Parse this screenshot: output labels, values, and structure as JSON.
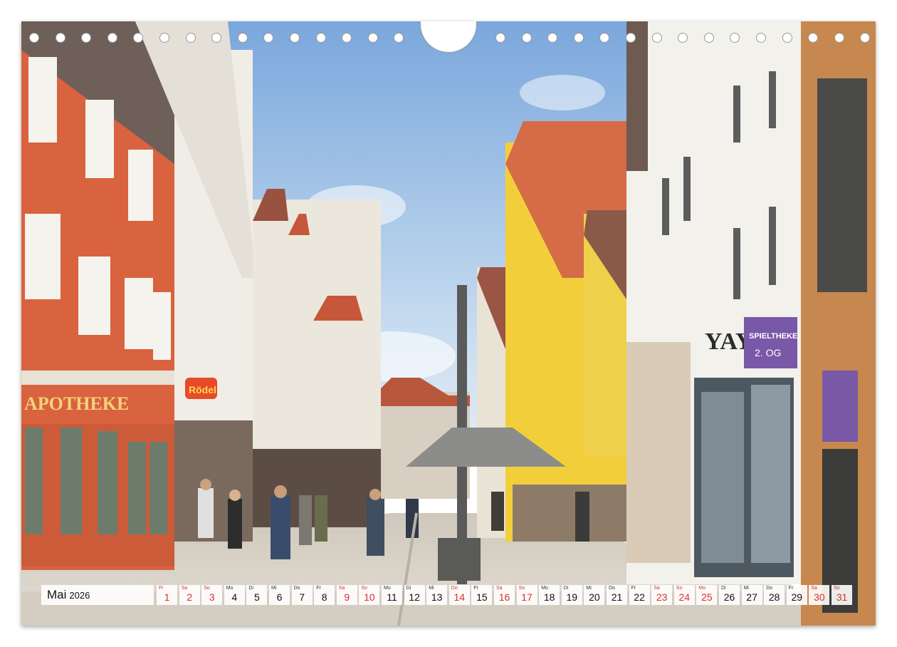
{
  "calendar": {
    "month": "Mai",
    "year": "2026",
    "highlight_color": "#d9302a",
    "days": [
      {
        "wd": "Fr",
        "d": "1",
        "hl": true
      },
      {
        "wd": "Sa",
        "d": "2",
        "hl": true
      },
      {
        "wd": "So",
        "d": "3",
        "hl": true
      },
      {
        "wd": "Mo",
        "d": "4",
        "hl": false
      },
      {
        "wd": "Di",
        "d": "5",
        "hl": false
      },
      {
        "wd": "Mi",
        "d": "6",
        "hl": false
      },
      {
        "wd": "Do",
        "d": "7",
        "hl": false
      },
      {
        "wd": "Fr",
        "d": "8",
        "hl": false
      },
      {
        "wd": "Sa",
        "d": "9",
        "hl": true
      },
      {
        "wd": "So",
        "d": "10",
        "hl": true
      },
      {
        "wd": "Mo",
        "d": "11",
        "hl": false
      },
      {
        "wd": "Di",
        "d": "12",
        "hl": false
      },
      {
        "wd": "Mi",
        "d": "13",
        "hl": false
      },
      {
        "wd": "Do",
        "d": "14",
        "hl": true
      },
      {
        "wd": "Fr",
        "d": "15",
        "hl": false
      },
      {
        "wd": "Sa",
        "d": "16",
        "hl": true
      },
      {
        "wd": "So",
        "d": "17",
        "hl": true
      },
      {
        "wd": "Mo",
        "d": "18",
        "hl": false
      },
      {
        "wd": "Di",
        "d": "19",
        "hl": false
      },
      {
        "wd": "Mi",
        "d": "20",
        "hl": false
      },
      {
        "wd": "Do",
        "d": "21",
        "hl": false
      },
      {
        "wd": "Fr",
        "d": "22",
        "hl": false
      },
      {
        "wd": "Sa",
        "d": "23",
        "hl": true
      },
      {
        "wd": "So",
        "d": "24",
        "hl": true
      },
      {
        "wd": "Mo",
        "d": "25",
        "hl": true
      },
      {
        "wd": "Di",
        "d": "26",
        "hl": false
      },
      {
        "wd": "Mi",
        "d": "27",
        "hl": false
      },
      {
        "wd": "Do",
        "d": "28",
        "hl": false
      },
      {
        "wd": "Fr",
        "d": "29",
        "hl": false
      },
      {
        "wd": "Sa",
        "d": "30",
        "hl": true
      },
      {
        "wd": "So",
        "d": "31",
        "hl": true
      }
    ]
  },
  "photo": {
    "signs": {
      "apotheke": "APOTHEKE",
      "yaya": "YAYA",
      "spieltheke": "SPIELTHEKE",
      "floor": "2. OG",
      "rodel": "Rödel"
    },
    "colors": {
      "sky": "#8fb6e0",
      "orange_house": "#d9623f",
      "yellow_house": "#f2cf3a",
      "roof": "#c9603f",
      "purple_sign": "#7a58a8",
      "pavement": "#d8d2c8"
    }
  }
}
